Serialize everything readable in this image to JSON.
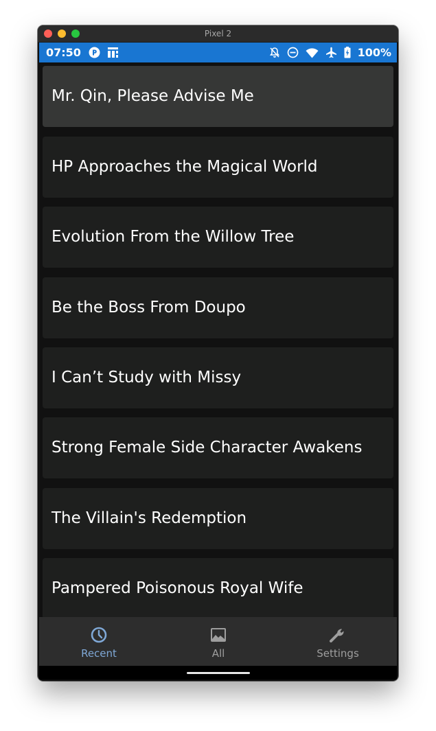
{
  "window": {
    "title": "Pixel 2"
  },
  "status_bar": {
    "time": "07:50",
    "battery_percent": "100%",
    "left_icons": [
      "pocket-casts-icon",
      "app-notification-icon"
    ],
    "right_icons": [
      "notifications-off-icon",
      "do-not-disturb-icon",
      "wifi-icon",
      "airplane-mode-icon",
      "battery-charging-icon"
    ],
    "color": "#1976d2"
  },
  "books": [
    {
      "title": "Mr. Qin, Please Advise Me",
      "selected": true
    },
    {
      "title": "HP Approaches the Magical World",
      "selected": false
    },
    {
      "title": "Evolution From the Willow Tree",
      "selected": false
    },
    {
      "title": "Be the Boss From Doupo",
      "selected": false
    },
    {
      "title": "I Can’t Study with Missy",
      "selected": false
    },
    {
      "title": "Strong Female Side Character Awakens",
      "selected": false
    },
    {
      "title": "The Villain's Redemption",
      "selected": false
    },
    {
      "title": "Pampered Poisonous Royal Wife",
      "selected": false
    }
  ],
  "bottom_nav": {
    "items": [
      {
        "label": "Recent",
        "icon": "clock-icon",
        "active": true
      },
      {
        "label": "All",
        "icon": "image-icon",
        "active": false
      },
      {
        "label": "Settings",
        "icon": "wrench-icon",
        "active": false
      }
    ],
    "active_color": "#7fa8d6",
    "inactive_color": "#9e9e9e"
  }
}
